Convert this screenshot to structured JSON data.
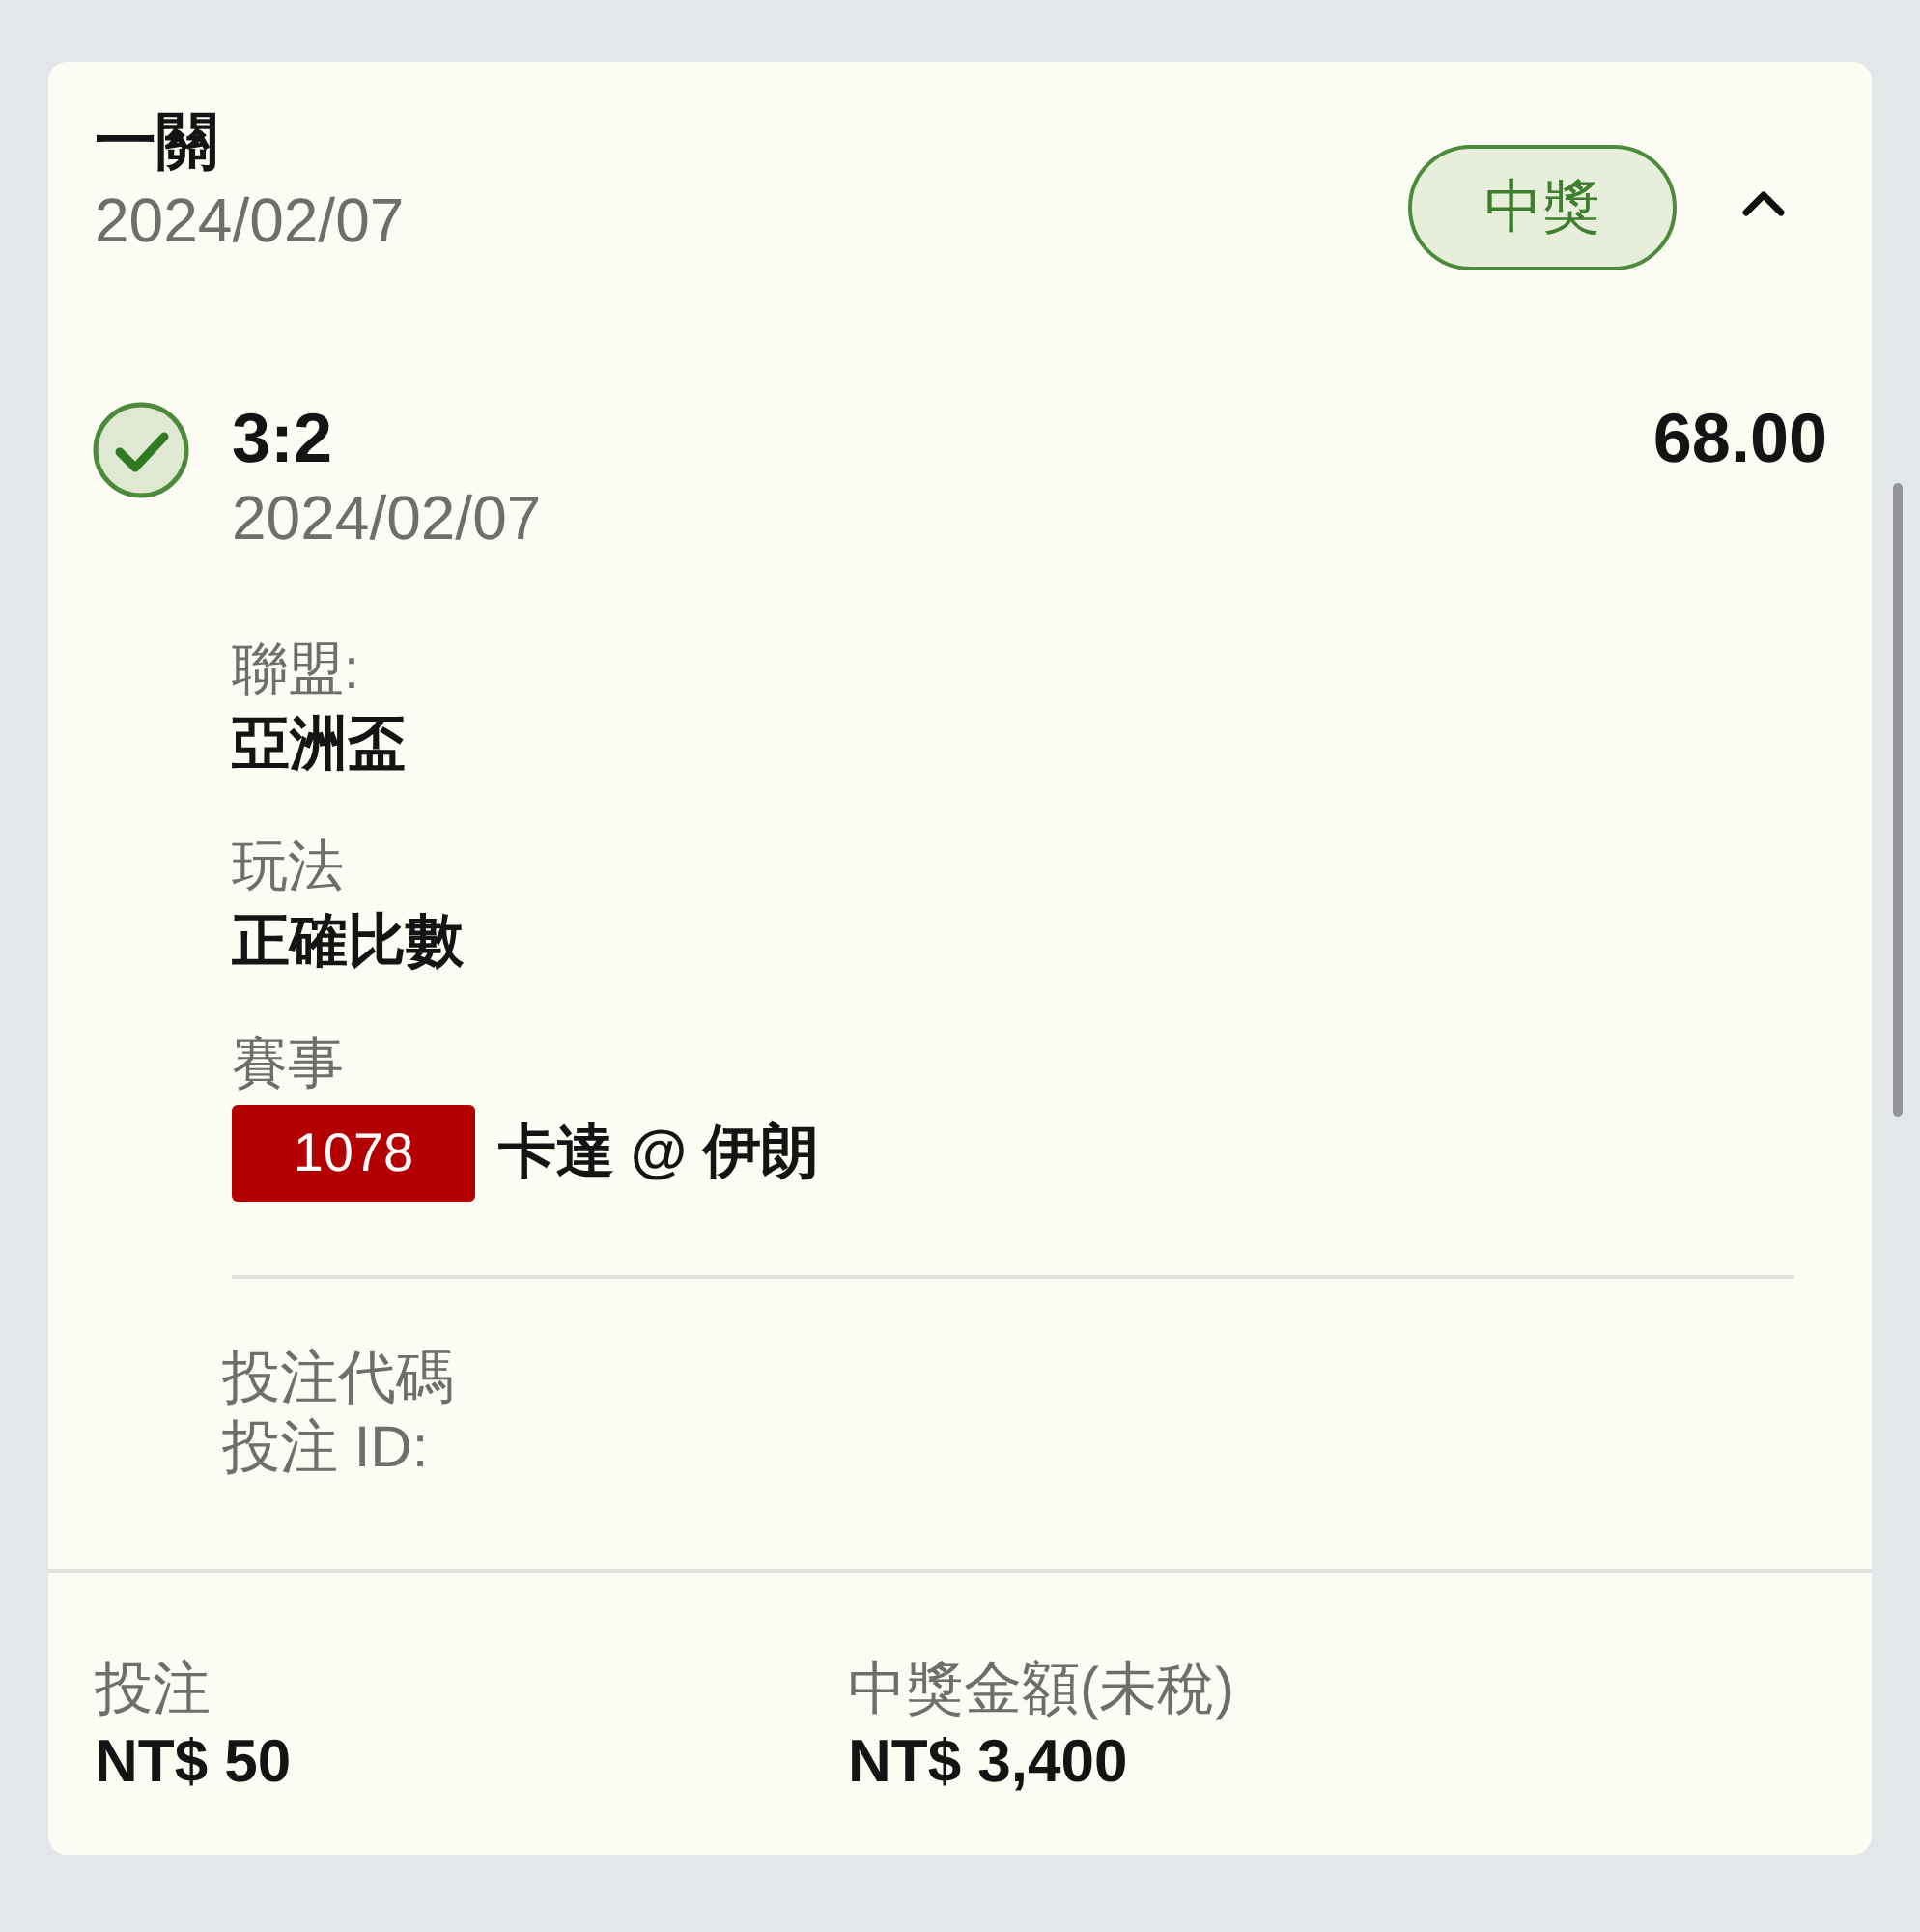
{
  "header": {
    "title": "一關",
    "date": "2024/02/07",
    "status_badge": "中獎",
    "expanded": true
  },
  "selection": {
    "won": true,
    "pick": "3:2",
    "odds": "68.00",
    "date": "2024/02/07",
    "details": [
      {
        "kind": "text",
        "label": "聯盟:",
        "value": "亞洲盃"
      },
      {
        "kind": "text",
        "label": "玩法",
        "value": "正確比數"
      },
      {
        "kind": "match",
        "label": "賽事",
        "match_number": "1078",
        "value": "卡達 @ 伊朗"
      }
    ]
  },
  "bet_refs": [
    "投注代碼",
    "投注 ID:"
  ],
  "footer": [
    {
      "label": "投注",
      "value": "NT$ 50"
    },
    {
      "label": "中獎金額(未稅)",
      "value": "NT$ 3,400"
    }
  ]
}
